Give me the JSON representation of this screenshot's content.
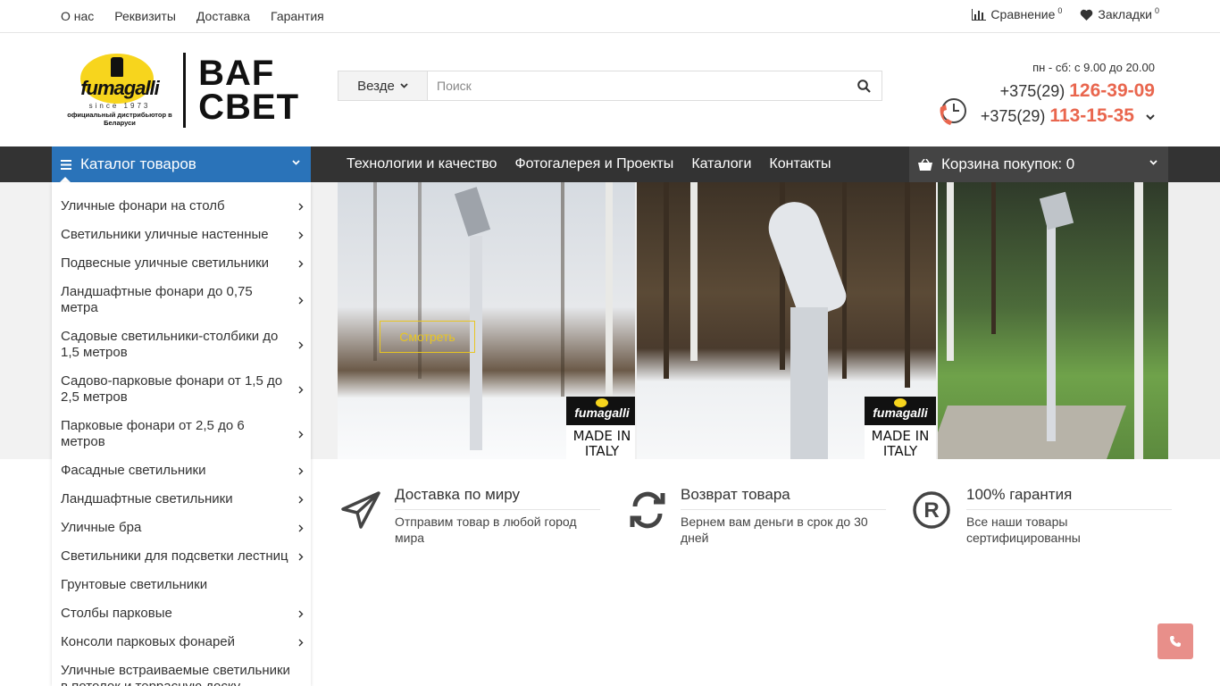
{
  "topbar": {
    "links": [
      "О нас",
      "Реквизиты",
      "Доставка",
      "Гарантия"
    ],
    "compare_label": "Сравнение",
    "compare_count": "0",
    "bookmarks_label": "Закладки",
    "bookmarks_count": "0"
  },
  "logo": {
    "brand": "fumagalli",
    "since": "since 1973",
    "distributor": "официальный дистрибьютор в Беларуси",
    "store_line1": "BAF",
    "store_line2": "СВЕТ"
  },
  "search": {
    "scope": "Везде",
    "placeholder": "Поиск"
  },
  "contacts": {
    "hours": "пн - сб: с 9.00 до 20.00",
    "phone1_prefix": "+375(29)",
    "phone1_number": "126-39-09",
    "phone2_prefix": "+375(29)",
    "phone2_number": "113-15-35"
  },
  "nav": {
    "catalog_label": "Каталог товаров",
    "links": [
      "Технологии и качество",
      "Фотогалерея и Проекты",
      "Каталоги",
      "Контакты"
    ],
    "cart_label": "Корзина покупок: 0"
  },
  "sidebar": {
    "items": [
      {
        "label": "Уличные фонари на столб",
        "sub": true
      },
      {
        "label": "Светильники уличные настенные",
        "sub": true
      },
      {
        "label": "Подвесные уличные светильники",
        "sub": true
      },
      {
        "label": "Ландшафтные фонари до 0,75 метра",
        "sub": true
      },
      {
        "label": "Садовые светильники-столбики до 1,5 метров",
        "sub": true
      },
      {
        "label": "Садово-парковые фонари от 1,5 до 2,5 метров",
        "sub": true
      },
      {
        "label": "Парковые фонари от 2,5 до 6 метров",
        "sub": true
      },
      {
        "label": "Фасадные светильники",
        "sub": true
      },
      {
        "label": "Ландшафтные светильники",
        "sub": true
      },
      {
        "label": "Уличные бра",
        "sub": true
      },
      {
        "label": "Светильники для подсветки лестниц",
        "sub": true
      },
      {
        "label": "Грунтовые светильники",
        "sub": false
      },
      {
        "label": "Столбы парковые",
        "sub": true
      },
      {
        "label": "Консоли парковых фонарей",
        "sub": true
      },
      {
        "label": "Уличные встраиваемые светильники в потолок и террасную доску (декинг)",
        "sub": false
      }
    ]
  },
  "banner": {
    "view_button": "Смотреть",
    "badge_brand": "fumagalli",
    "badge_text_line1": "MADE IN",
    "badge_text_line2": "ITALY"
  },
  "features": [
    {
      "title": "Доставка по миру",
      "desc": "Отправим товар в любой город мира",
      "icon": "paper-plane-icon"
    },
    {
      "title": "Возврат товара",
      "desc": "Вернем вам деньги в срок до 30 дней",
      "icon": "refresh-icon"
    },
    {
      "title": "100% гарантия",
      "desc": "Все наши товары сертифицированны",
      "icon": "registered-icon"
    }
  ],
  "colors": {
    "accent_blue": "#2a73b9",
    "nav_dark": "#333333",
    "phone_accent": "#e9664e",
    "call_button": "#e88f8a"
  }
}
